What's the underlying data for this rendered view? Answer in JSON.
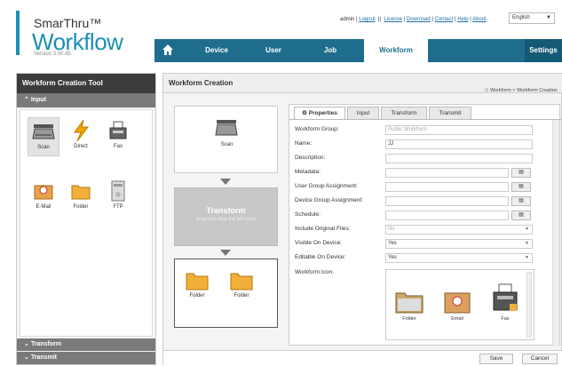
{
  "brand": {
    "line1": "SmarThru™",
    "line2": "Workflow",
    "version": "Version 3.00.45"
  },
  "toplinks": {
    "user": "admin",
    "logout": "Logout",
    "sep": "||",
    "license": "License",
    "download": "Download",
    "contact": "Contact",
    "help": "Help",
    "about": "About",
    "language": "English"
  },
  "nav": {
    "items": [
      "Device",
      "User",
      "Job",
      "Workform"
    ],
    "settings": "Settings",
    "active": "Workform"
  },
  "left": {
    "title": "Workform Creation Tool",
    "section_input": "Input",
    "tiles": [
      "Scan",
      "Direct",
      "Fax",
      "E-Mail",
      "Folder",
      "FTP"
    ],
    "section_transform": "Transform",
    "section_transmit": "Transmit"
  },
  "main": {
    "title": "Workform Creation",
    "breadcrumb": "Workform > Workform Creation"
  },
  "flow": {
    "input_label": "Scan",
    "transform_title": "Transform",
    "transform_hint": "Drag and drop the left icons",
    "out_labels": [
      "Folder",
      "Folder"
    ]
  },
  "props": {
    "tabs": [
      "Properties",
      "Input",
      "Transform",
      "Transmit"
    ],
    "fields": [
      {
        "label": "Workform Group:",
        "value": "Public Workform"
      },
      {
        "label": "Name:",
        "value": "JJ"
      },
      {
        "label": "Description:",
        "value": ""
      },
      {
        "label": "Metadata:",
        "value": ""
      },
      {
        "label": "User Group Assignment:",
        "value": ""
      },
      {
        "label": "Device Group Assignment:",
        "value": ""
      },
      {
        "label": "Schedule:",
        "value": ""
      },
      {
        "label": "Include Original Files:",
        "value": "No"
      },
      {
        "label": "Visible On Device:",
        "value": "Yes"
      },
      {
        "label": "Editable On Device:",
        "value": "Yes"
      },
      {
        "label": "Workform Icon:",
        "value": ""
      }
    ],
    "icons": [
      "Folder",
      "Email",
      "Fax"
    ]
  },
  "footer": {
    "save": "Save",
    "cancel": "Cancel"
  },
  "colors": {
    "accent": "#1a8fb5",
    "nav": "#1f6d8c"
  }
}
